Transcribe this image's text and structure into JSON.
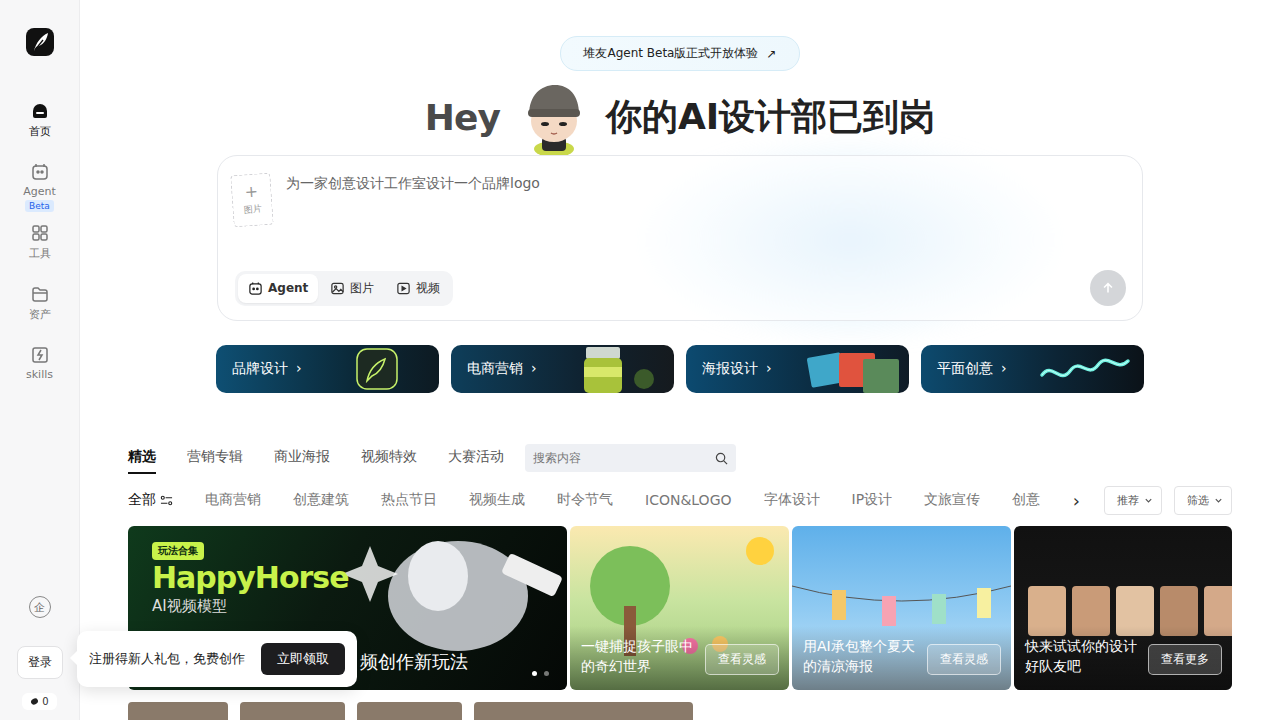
{
  "sidebar": {
    "items": [
      {
        "label": "首页",
        "badge": "",
        "selected": true
      },
      {
        "label": "Agent",
        "badge": "Beta",
        "selected": false
      },
      {
        "label": "工具",
        "badge": "",
        "selected": false
      },
      {
        "label": "资产",
        "badge": "",
        "selected": false
      },
      {
        "label": "skills",
        "badge": "",
        "selected": false
      }
    ],
    "enterprise": "企",
    "login": "登录",
    "credits": "0"
  },
  "announcement": {
    "text": "堆友Agent Beta版正式开放体验",
    "icon": "↗"
  },
  "hero": {
    "greeting": "Hey",
    "title": "你的AI设计部已到岗"
  },
  "composer": {
    "upload_plus": "+",
    "upload_label": "图片",
    "placeholder": "为一家创意设计工作室设计一个品牌logo",
    "modes": [
      {
        "label": "Agent",
        "selected": true
      },
      {
        "label": "图片",
        "selected": false
      },
      {
        "label": "视频",
        "selected": false
      }
    ]
  },
  "categories": [
    {
      "label": "品牌设计",
      "arrow": "›"
    },
    {
      "label": "电商营销",
      "arrow": "›"
    },
    {
      "label": "海报设计",
      "arrow": "›"
    },
    {
      "label": "平面创意",
      "arrow": "›"
    }
  ],
  "tabs": [
    {
      "label": "精选",
      "selected": true
    },
    {
      "label": "营销专辑",
      "selected": false
    },
    {
      "label": "商业海报",
      "selected": false
    },
    {
      "label": "视频特效",
      "selected": false
    },
    {
      "label": "大赛活动",
      "selected": false
    }
  ],
  "search": {
    "placeholder": "搜索内容"
  },
  "filters": [
    {
      "label": "全部",
      "selected": true
    },
    {
      "label": "电商营销",
      "selected": false
    },
    {
      "label": "创意建筑",
      "selected": false
    },
    {
      "label": "热点节日",
      "selected": false
    },
    {
      "label": "视频生成",
      "selected": false
    },
    {
      "label": "时令节气",
      "selected": false
    },
    {
      "label": "ICON&LOGO",
      "selected": false
    },
    {
      "label": "字体设计",
      "selected": false
    },
    {
      "label": "IP设计",
      "selected": false
    },
    {
      "label": "文旅宣传",
      "selected": false
    },
    {
      "label": "创意",
      "selected": false
    }
  ],
  "filters_more": "›",
  "sort": "推荐",
  "filter_button": "筛选",
  "banner": {
    "tag": "玩法合集",
    "title": "HappyHorse",
    "subtitle": "AI视频模型",
    "caption": "频创作新玩法",
    "slides": [
      {
        "selected": true
      },
      {
        "selected": false
      }
    ]
  },
  "cards": [
    {
      "caption": "一键捕捉孩子眼中的奇幻世界",
      "button": "查看灵感"
    },
    {
      "caption": "用AI承包整个夏天的清凉海报",
      "button": "查看灵感"
    },
    {
      "caption": "快来试试你的设计好队友吧",
      "button": "查看更多"
    }
  ],
  "tooltip": {
    "text": "注册得新人礼包，免费创作",
    "button": "立即领取"
  }
}
